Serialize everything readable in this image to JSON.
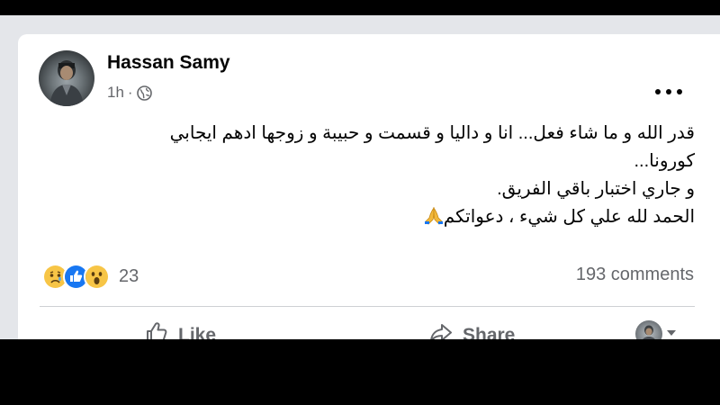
{
  "post": {
    "author": "Hassan Samy",
    "time": "1h",
    "separator": "·",
    "audience_icon": "globe-icon",
    "text_lines": [
      "قدر الله و ما شاء فعل... انا و داليا و قسمت و حبيبة و زوجها ادهم ايجابي",
      "كورونا...",
      "و جاري اختبار باقي الفريق.",
      "الحمد لله علي كل شيء ، دعواتكم"
    ],
    "reactions": {
      "icons": [
        "sad-reaction-icon",
        "like-reaction-icon",
        "wow-reaction-icon"
      ],
      "count": "23"
    },
    "comments_label": "193 comments"
  },
  "actions": {
    "like_label": "Like",
    "share_label": "Share"
  },
  "colors": {
    "accent": "#1877f2",
    "text": "#050505",
    "secondary_text": "#65676b",
    "divider": "#ced0d4",
    "background": "#e4e6ea"
  }
}
